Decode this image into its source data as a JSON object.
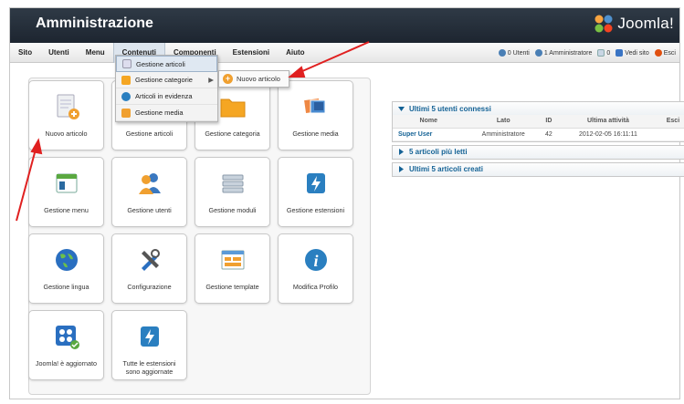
{
  "header": {
    "title": "Amministrazione",
    "logo_text": "Joomla!"
  },
  "menubar": {
    "items": [
      "Sito",
      "Utenti",
      "Menu",
      "Contenuti",
      "Componenti",
      "Estensioni",
      "Aiuto"
    ],
    "status": {
      "users": "0 Utenti",
      "admins": "1 Amministratore",
      "messages": "0",
      "view_site": "Vedi sito",
      "logout": "Esci"
    }
  },
  "dropdown": {
    "items": [
      "Gestione articoli",
      "Gestione categorie",
      "Articoli in evidenza",
      "Gestione media"
    ],
    "submenu": "Nuovo articolo"
  },
  "tiles": [
    "Nuovo articolo",
    "Gestione articoli",
    "Gestione categoria",
    "Gestione media",
    "Gestione menu",
    "Gestione utenti",
    "Gestione moduli",
    "Gestione estensioni",
    "Gestione lingua",
    "Configurazione",
    "Gestione template",
    "Modifica Profilo",
    "Joomla! è aggiornato",
    "Tutte le estensioni sono aggiornate"
  ],
  "panel": {
    "logged_title": "Ultimi 5 utenti connessi",
    "columns": [
      "Nome",
      "Lato",
      "ID",
      "Ultima attività",
      "Esci"
    ],
    "rows": [
      {
        "name": "Super User",
        "side": "Amministratore",
        "id": "42",
        "last": "2012-02-05 16:11:11",
        "logout": ""
      }
    ],
    "popular_title": "5 articoli più letti",
    "latest_title": "Ultimi 5 articoli creati"
  },
  "colors": {
    "header": "#1d2530",
    "link": "#146295",
    "accent": "#f0a030",
    "arrow": "#e02020"
  }
}
